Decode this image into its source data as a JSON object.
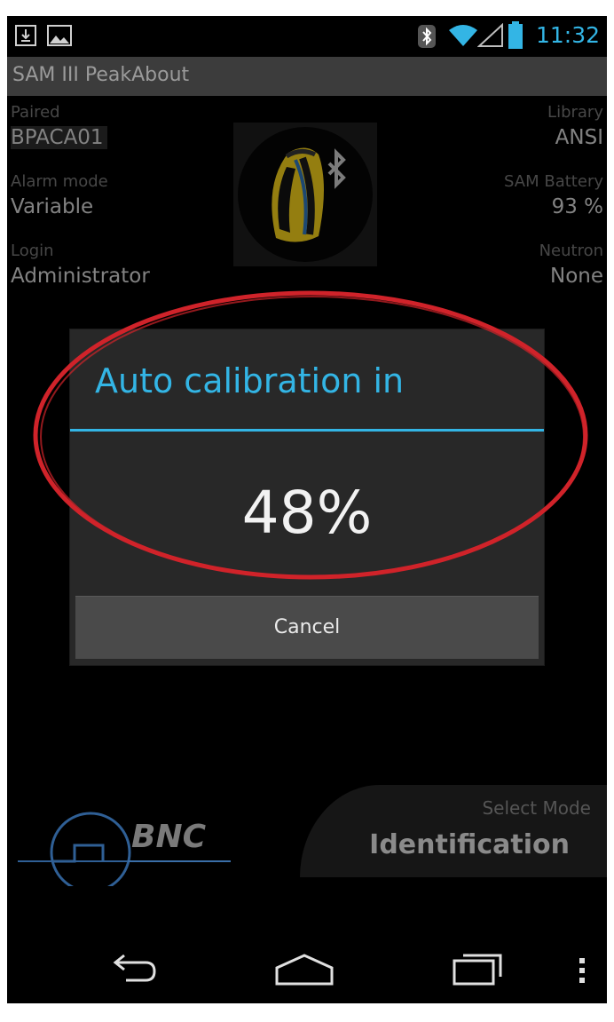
{
  "status_bar": {
    "time": "11:32",
    "icons": [
      "download-icon",
      "image-icon",
      "bluetooth-icon",
      "wifi-icon",
      "signal-icon",
      "battery-icon"
    ]
  },
  "app": {
    "title": "SAM III PeakAbout"
  },
  "info": {
    "paired_label": "Paired",
    "paired_value": "BPACA01",
    "alarm_mode_label": "Alarm mode",
    "alarm_mode_value": "Variable",
    "login_label": "Login",
    "login_value": "Administrator",
    "library_label": "Library",
    "library_value": "ANSI",
    "battery_label": "SAM Battery",
    "battery_value": "93 %",
    "neutron_label": "Neutron",
    "neutron_value": "None",
    "device_icon": "backpack-device-icon"
  },
  "dialog": {
    "title": "Auto calibration in",
    "percent": "48%",
    "cancel_label": "Cancel"
  },
  "mode": {
    "label": "Select Mode",
    "value": "Identification"
  },
  "logo": {
    "text": "BNC"
  },
  "nav": {
    "items": [
      "back-icon",
      "home-icon",
      "recents-icon",
      "overflow-menu-icon"
    ]
  },
  "colors": {
    "accent": "#33b5e5",
    "annotation": "#d0232a"
  }
}
